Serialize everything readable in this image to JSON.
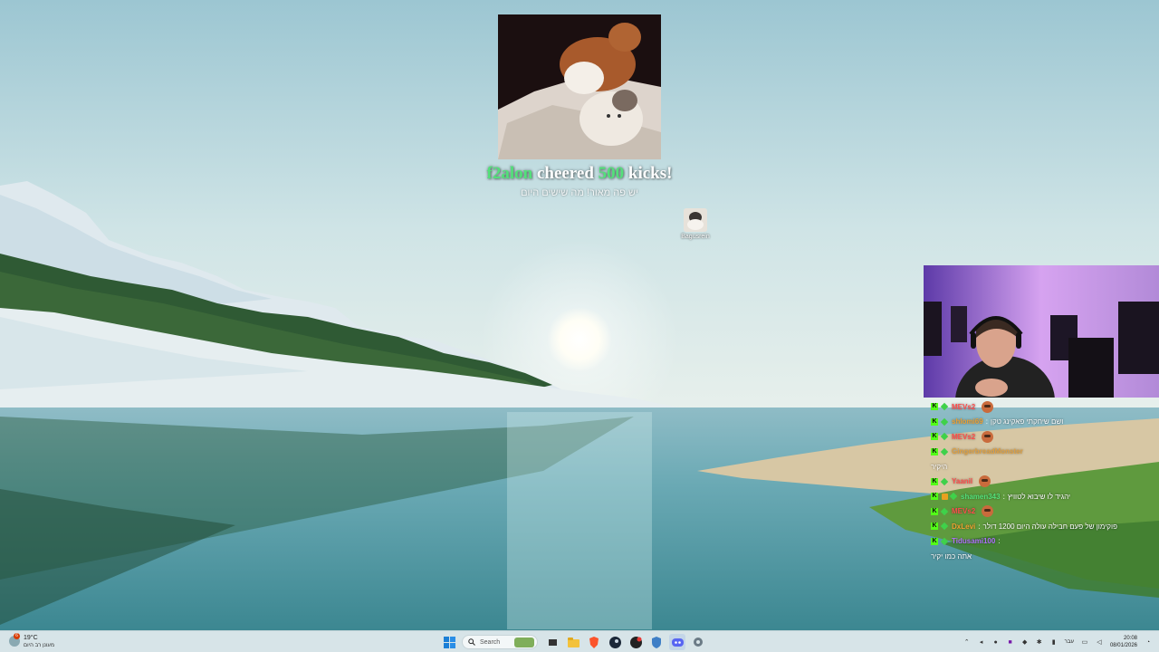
{
  "alert": {
    "username": "f2alon",
    "cheered_text": "cheered",
    "amount": "500",
    "unit_text": "kicks!",
    "message": "יש פה מאור! מה שישים היום"
  },
  "desktop": {
    "icon_label": "Bagusrein"
  },
  "chat": {
    "messages": [
      {
        "user": "MEVs2",
        "user_color": "#ff4d4d",
        "text": "",
        "emote": true
      },
      {
        "user": "shlomi69",
        "user_color": "#f0a030",
        "text": "ושם שיחקתי פאקינג טקן"
      },
      {
        "user": "MEVs2",
        "user_color": "#ff4d4d",
        "text": "",
        "emote": true
      },
      {
        "user": "GingerbreadMonster",
        "user_color": "#e0a040",
        "text": ""
      },
      {
        "plain": "היקיר"
      },
      {
        "user": "Yaanil",
        "user_color": "#ff4d4d",
        "text": "",
        "emote": true
      },
      {
        "user": "shamen343",
        "user_color": "#53e07a",
        "text": "יהגיד לו שיבוא לטוויץ",
        "sub": true
      },
      {
        "user": "MEVs2",
        "user_color": "#ff4d4d",
        "text": "",
        "emote": true
      },
      {
        "user": "DxLevi",
        "user_color": "#f0a030",
        "text": "פוקימון של פעם חבילה עולה היום 1200 דולר"
      },
      {
        "user": "Tidusami100",
        "user_color": "#b070ff",
        "text": ""
      },
      {
        "plain": "אתה כמו יקיר"
      }
    ]
  },
  "taskbar": {
    "weather_temp": "19°C",
    "weather_desc": "מעונן רב היום",
    "weather_badge": "6",
    "search_placeholder": "Search",
    "tray_lang": "עבר",
    "clock_time": "20:08",
    "clock_date": "08/01/2026"
  }
}
